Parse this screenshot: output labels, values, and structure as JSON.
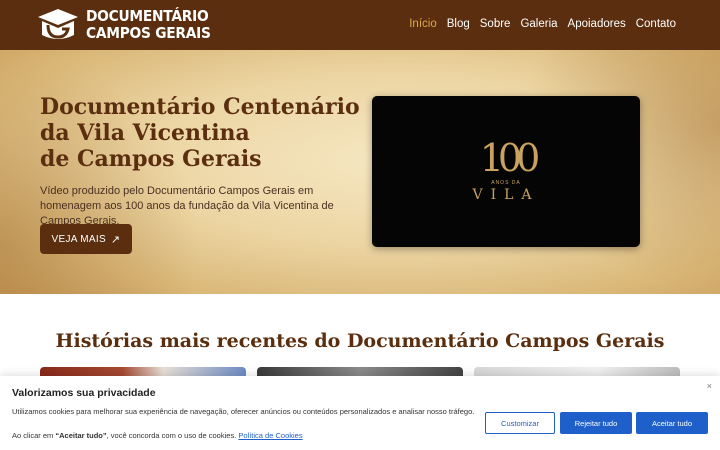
{
  "header": {
    "logo_line1": "DOCUMENTÁRIO",
    "logo_line2": "CAMPOS GERAIS",
    "nav": [
      "Início",
      "Blog",
      "Sobre",
      "Galeria",
      "Apoiadores",
      "Contato"
    ]
  },
  "hero": {
    "title_line1": "Documentário Centenário",
    "title_line2": "da Vila Vicentina",
    "title_line3": "de Campos Gerais",
    "description": "Vídeo produzido pelo Documentário Campos Gerais em homenagem aos 100 anos da fundação da Vila Vicentina de Campos Gerais.",
    "cta_label": "VEJA MAIS",
    "video": {
      "number": "100",
      "subtitle": "ANOS DA",
      "word": "VILA"
    }
  },
  "stories": {
    "title": "Histórias mais recentes do Documentário Campos Gerais"
  },
  "cookie": {
    "title": "Valorizamos sua privacidade",
    "text": "Utilizamos cookies para melhorar sua experiência de navegação, oferecer anúncios ou conteúdos personalizados e analisar nosso tráfego.",
    "text2_prefix": "Ao clicar em ",
    "text2_bold": "“Aceitar tudo”",
    "text2_suffix": ", você concorda com o uso de cookies.",
    "policy_link": "Política de Cookies",
    "close_label": "×",
    "btn_customize": "Customizar",
    "btn_reject": "Rejeitar tudo",
    "btn_accept": "Aceitar tudo"
  },
  "colors": {
    "brand": "#5a2e0e",
    "accent": "#e0a84a",
    "button_blue": "#1f5fc9"
  }
}
